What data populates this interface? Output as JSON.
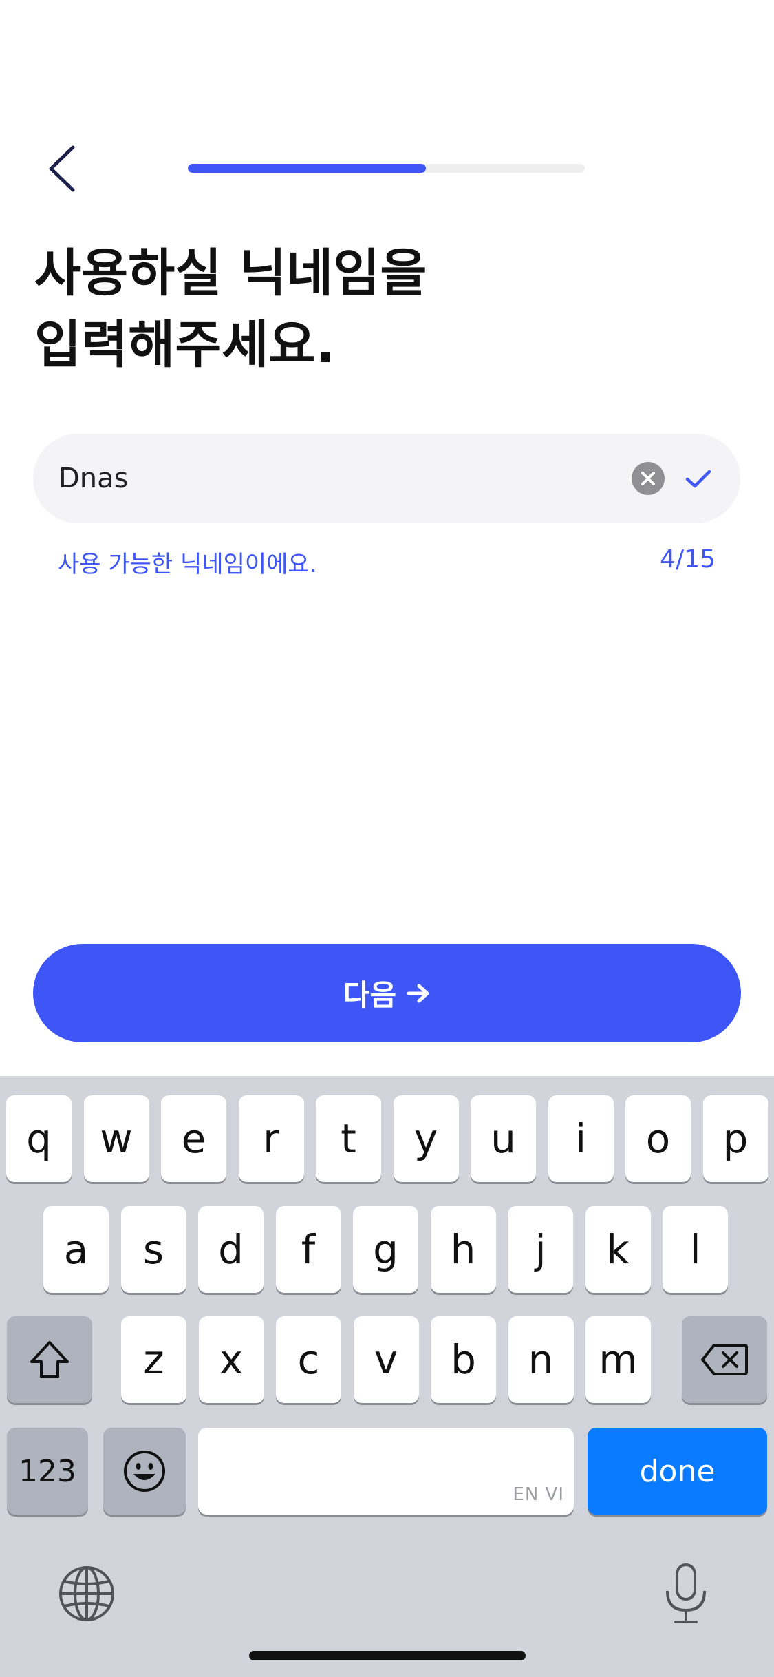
{
  "header": {
    "back_icon": "chevron-left-icon",
    "progress_fraction": 0.6
  },
  "title": {
    "line1": "사용하실 닉네임을",
    "line2": "입력해주세요."
  },
  "nickname": {
    "value": "Dnas",
    "clear_icon": "clear-circle-icon",
    "valid_icon": "check-icon",
    "helper": "사용 가능한 닉네임이에요.",
    "counter": "4/15"
  },
  "next_button": {
    "label": "다음",
    "icon": "arrow-right-icon"
  },
  "keyboard": {
    "row1": [
      "q",
      "w",
      "e",
      "r",
      "t",
      "y",
      "u",
      "i",
      "o",
      "p"
    ],
    "row2": [
      "a",
      "s",
      "d",
      "f",
      "g",
      "h",
      "j",
      "k",
      "l"
    ],
    "row3": [
      "z",
      "x",
      "c",
      "v",
      "b",
      "n",
      "m"
    ],
    "numbers_label": "123",
    "space_hint": "EN VI",
    "done_label": "done",
    "shift_icon": "shift-icon",
    "delete_icon": "backspace-icon",
    "emoji_icon": "emoji-icon",
    "globe_icon": "globe-icon",
    "mic_icon": "microphone-icon"
  },
  "colors": {
    "accent": "#3F56F6",
    "done_key": "#0A7AFF",
    "keyboard_bg": "#D1D4DB"
  }
}
